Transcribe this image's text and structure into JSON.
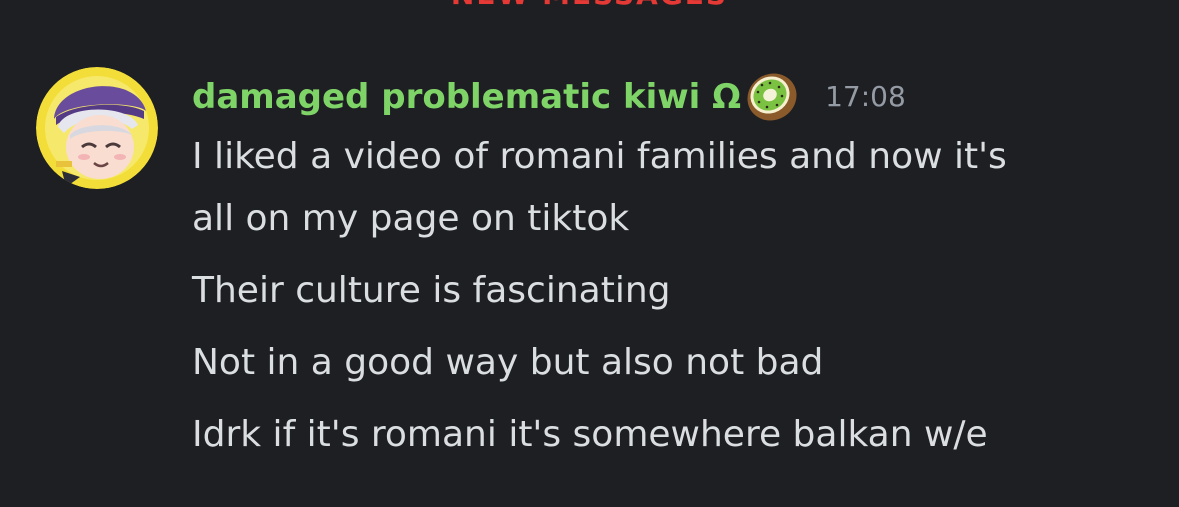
{
  "divider": {
    "label": "NEW MESSAGES"
  },
  "message": {
    "author": "damaged problematic kiwi Ω",
    "author_color": "#7fd468",
    "badge_icon": "kiwi-icon",
    "timestamp": "17:08",
    "avatar_icon": "avatar",
    "lines": [
      "I liked a video of romani families and now it's",
      "all on my page on tiktok",
      "Their culture is fascinating",
      "Not in a good way but also not bad",
      "Idrk if it's romani it's somewhere balkan w/e"
    ]
  },
  "colors": {
    "background": "#1e1f22",
    "text": "#dbdee1",
    "timestamp": "#949ba4",
    "divider": "#e53935"
  }
}
